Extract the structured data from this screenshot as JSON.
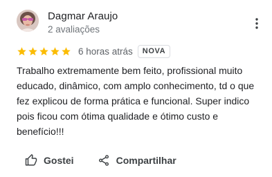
{
  "reviewer": {
    "name": "Dagmar Araujo",
    "meta": "2 avaliações"
  },
  "review": {
    "rating": 5,
    "rating_max": 5,
    "time": "6 horas atrás",
    "badge": "NOVA",
    "text": "Trabalho extremamente bem feito, profissional muito educado, dinâmico, com amplo conhecimento, td o que fez explicou de forma prática e funcional. Super indico pois ficou com ótima qualidade e ótimo custo e benefício!!!"
  },
  "actions": {
    "like_label": "Gostei",
    "share_label": "Compartilhar"
  },
  "icons": {
    "more": "more-vert-icon",
    "star": "star-icon",
    "like": "thumb-up-icon",
    "share": "share-icon"
  },
  "colors": {
    "star": "#fbbc04",
    "text": "#202124",
    "secondary": "#70757a",
    "icon": "#3c4043"
  }
}
